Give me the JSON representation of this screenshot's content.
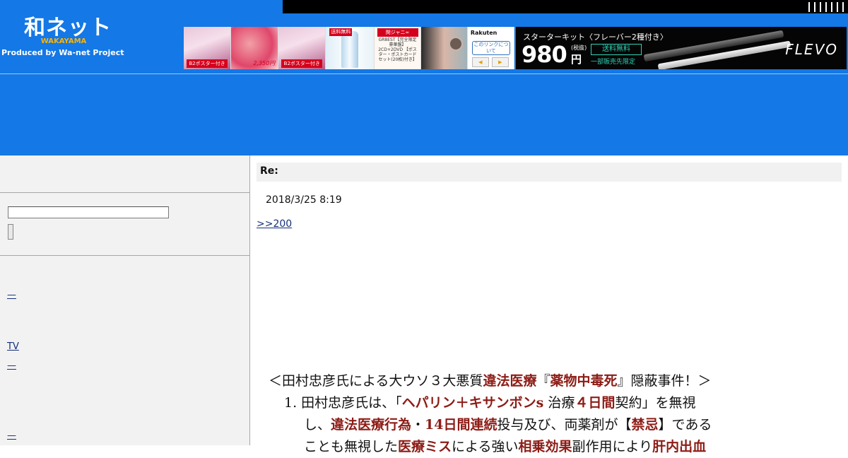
{
  "header": {
    "logo_main": "和ネット",
    "logo_sub": "WAKAYAMA",
    "logo_tagline": "Produced by Wa-net Project"
  },
  "ads": {
    "rakuten_brand": "Rakuten",
    "rakuten_link": "このリンクについて",
    "rakuten_prev": "◀",
    "rakuten_next": "▶",
    "ad1_badge": "B2ポスター付き",
    "ad2_price": "2,350円",
    "ad3_badge": "B2ポスター付き",
    "ad4_tag": "送料無料",
    "ad5_head": "関ジャニ∞",
    "ad5_body": "GR8EST【完全限定豪華盤】2CD+2DVD 【ポスター・ポストカードセット(20枚)付き】",
    "flevo_headline": "スターターキット〈フレーバー2種付き〉",
    "flevo_price": "980",
    "flevo_tax": "(税抜)",
    "flevo_yen": "円",
    "flevo_free": "送料無料",
    "flevo_limited": "一部販売先限定",
    "flevo_brand": "FLEVO"
  },
  "sidebar": {
    "search_value": "",
    "links": [
      "—",
      "TV",
      "—",
      "—"
    ]
  },
  "post": {
    "title": "Re:",
    "date": "2018/3/25 8:19",
    "reply_link": ">>200"
  },
  "article": {
    "heading_pre": "＜田村忠彦氏による大ウソ３大悪質",
    "heading_red1": "違法医療",
    "heading_mid": "『",
    "heading_red2": "薬物中毒死",
    "heading_post": "』隠蔽事件！＞",
    "l1_a": "1. 田村忠彦氏は、「",
    "l1_red1": "ヘパリン＋キサンボンs",
    "l1_b": " 治療",
    "l1_red2": "４日間",
    "l1_c": "契約」を無視",
    "l2_a": "し、",
    "l2_red1": "違法医療行為",
    "l2_b": "・",
    "l2_red2": "14日間連続",
    "l2_c": "投与及び、両薬剤が【",
    "l2_red3": "禁忌",
    "l2_d": "】である",
    "l3_a": "ことも無視した",
    "l3_red1": "医療ミス",
    "l3_b": "による強い",
    "l3_red2": "相乗効果",
    "l3_c": "副作用により",
    "l3_red3": "肝内出血"
  },
  "colors": {
    "header_blue": "#1478e6",
    "article_red": "#8d1c16",
    "link_blue": "#13307a"
  }
}
